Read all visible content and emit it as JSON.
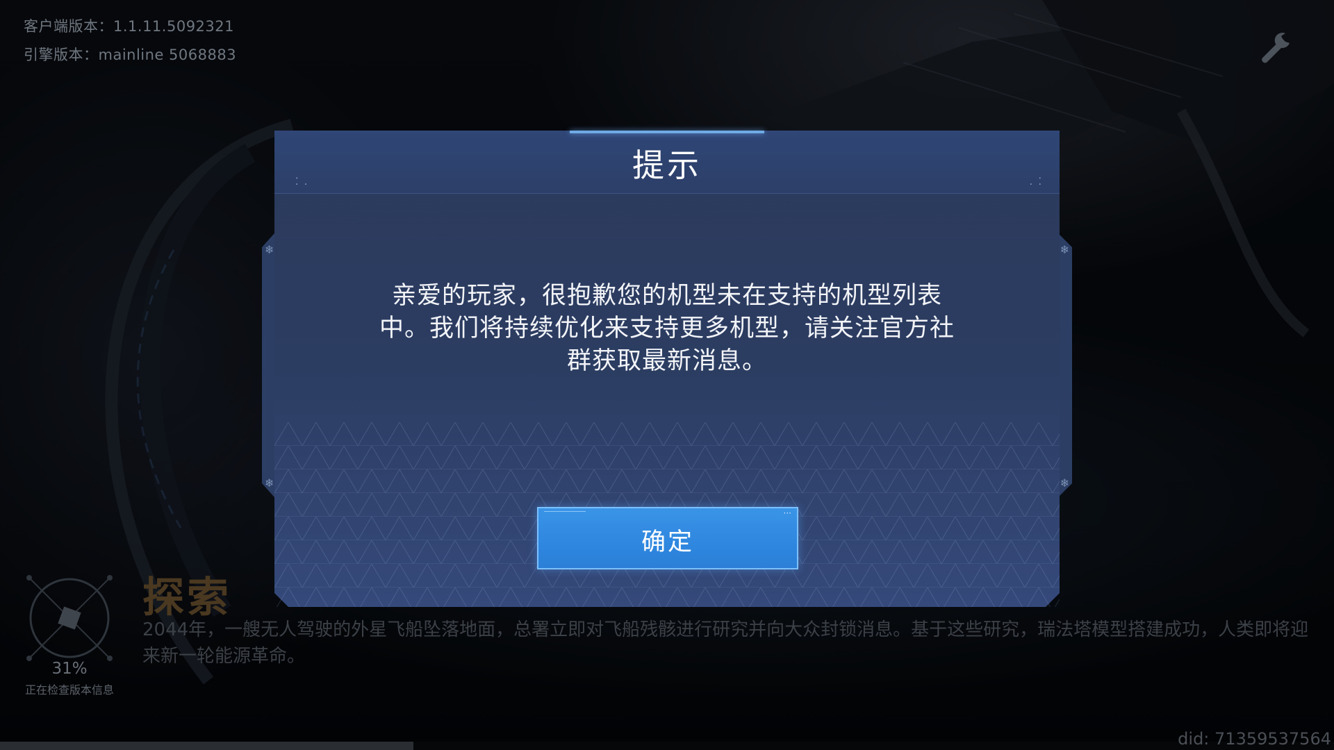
{
  "header": {
    "client_version": "客户端版本：1.1.11.5092321",
    "engine_version": "引擎版本：mainline 5068883"
  },
  "icons": {
    "settings": "wrench-icon",
    "loader": "loading-ring-icon"
  },
  "loading": {
    "percent": "31%",
    "progress": 0.31,
    "status": "正在检查版本信息"
  },
  "story": {
    "title": "探索",
    "description": "2044年，一艘无人驾驶的外星飞船坠落地面，总署立即对飞船残骸进行研究并向大众封锁消息。基于这些研究，瑞法塔模型搭建成功，人类即将迎来新一轮能源革命。"
  },
  "device_id": "did: 71359537564",
  "dialog": {
    "title": "提示",
    "message": "亲爱的玩家，很抱歉您的机型未在支持的机型列表中。我们将持续优化来支持更多机型，请关注官方社群获取最新消息。",
    "confirm_label": "确定"
  },
  "colors": {
    "dialog_bg": "#2c3d62",
    "button_blue": "#2f87df",
    "accent": "#6fa9e6"
  }
}
